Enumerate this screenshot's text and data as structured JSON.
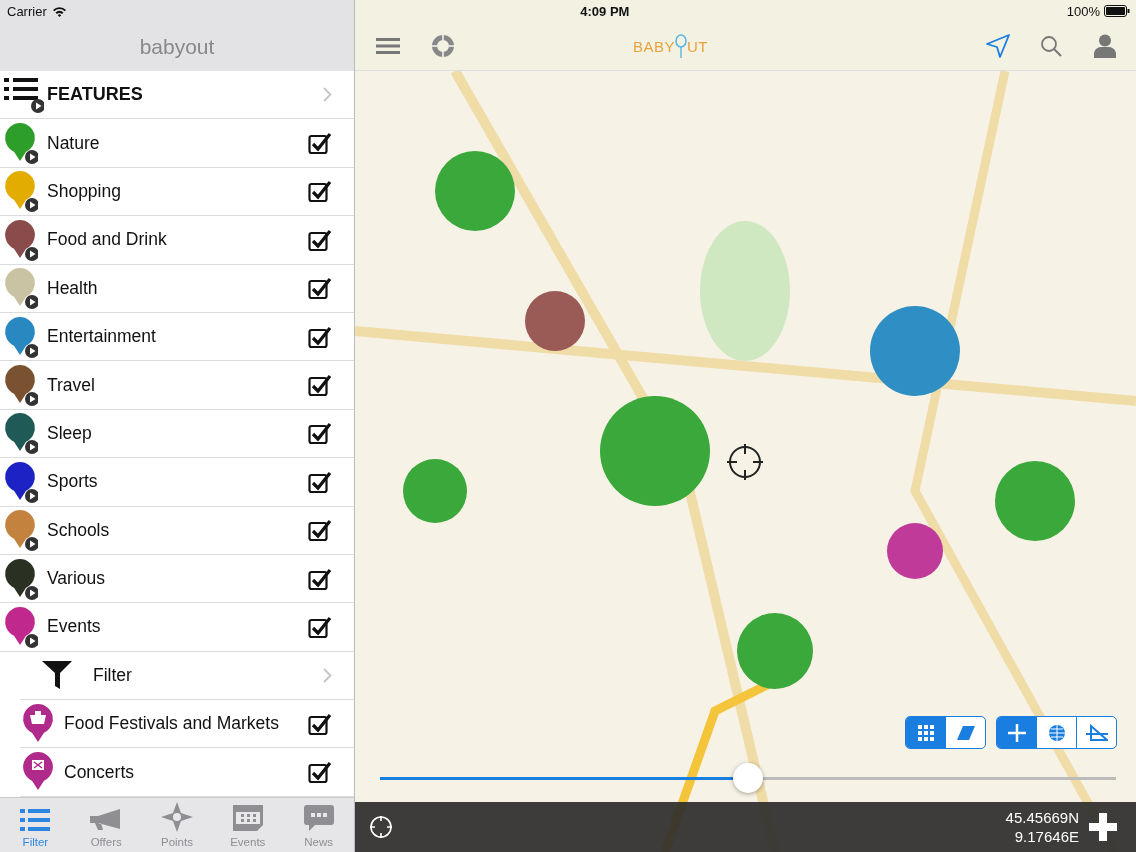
{
  "status_bar": {
    "carrier": "Carrier",
    "time": "4:09 PM",
    "battery": "100%"
  },
  "sidebar": {
    "title": "babyout",
    "items": [
      {
        "kind": "section",
        "label": "FEATURES"
      },
      {
        "kind": "category",
        "label": "Nature",
        "color": "#2e9e2a",
        "checked": true
      },
      {
        "kind": "category",
        "label": "Shopping",
        "color": "#e2ad00",
        "checked": true
      },
      {
        "kind": "category",
        "label": "Food and Drink",
        "color": "#8a4b4b",
        "checked": true
      },
      {
        "kind": "category",
        "label": "Health",
        "color": "#c9c2a3",
        "checked": true
      },
      {
        "kind": "category",
        "label": "Entertainment",
        "color": "#2a88c0",
        "checked": true
      },
      {
        "kind": "category",
        "label": "Travel",
        "color": "#7a5232",
        "checked": true
      },
      {
        "kind": "category",
        "label": "Sleep",
        "color": "#1f5a56",
        "checked": true
      },
      {
        "kind": "category",
        "label": "Sports",
        "color": "#1c22c4",
        "checked": true
      },
      {
        "kind": "category",
        "label": "Schools",
        "color": "#c4823f",
        "checked": true
      },
      {
        "kind": "category",
        "label": "Various",
        "color": "#2b3122",
        "checked": true
      },
      {
        "kind": "category",
        "label": "Events",
        "color": "#c0288e",
        "checked": true
      },
      {
        "kind": "filter",
        "label": "Filter",
        "children": [
          {
            "label": "Food Festivals and Markets",
            "checked": true
          },
          {
            "label": "Concerts",
            "checked": true
          }
        ]
      }
    ]
  },
  "tab_bar": [
    {
      "label": "Filter",
      "selected": true
    },
    {
      "label": "Offers",
      "selected": false
    },
    {
      "label": "Points",
      "selected": false
    },
    {
      "label": "Events",
      "selected": false
    },
    {
      "label": "News",
      "selected": false
    }
  ],
  "toolbar": {
    "logo": {
      "before": "BABY",
      "after": "UT"
    }
  },
  "map": {
    "layer_toggle": [
      {
        "selected": true
      },
      {
        "selected": false
      }
    ],
    "mode_toggle": [
      {
        "selected": true
      },
      {
        "selected": false
      },
      {
        "selected": false
      }
    ],
    "slider": {
      "level": 0.5
    },
    "coordinates": {
      "latitude": "45.45669N",
      "longitude": "9.17646E"
    }
  }
}
